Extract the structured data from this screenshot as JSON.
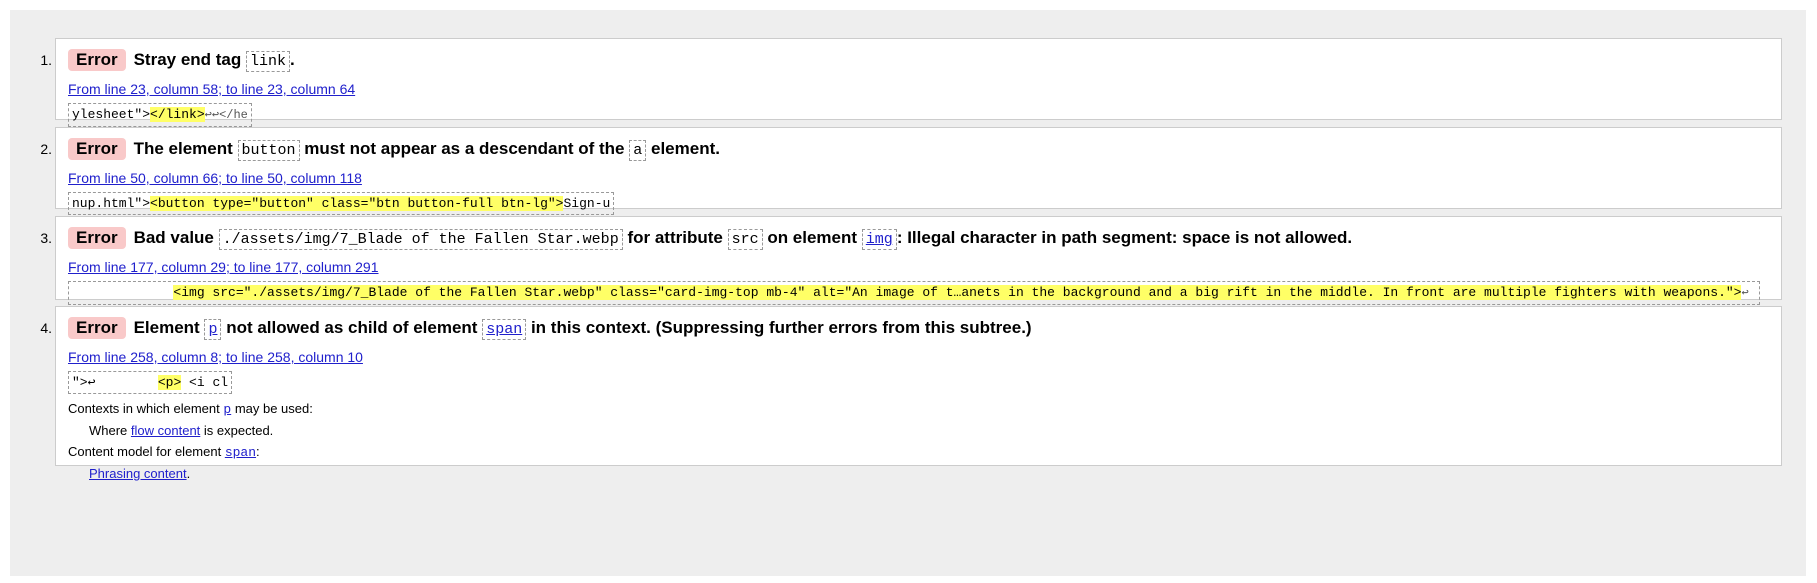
{
  "messages": [
    {
      "number": "1.",
      "type": "Error",
      "parts": [
        "Stray end tag",
        "link",
        "."
      ],
      "location": "From line 23, column 58; to line 23, column 64",
      "extract_before": "ylesheet\">",
      "extract_highlight": "</link>",
      "extract_after": "↩↩</he"
    },
    {
      "number": "2.",
      "type": "Error",
      "parts": [
        "The element",
        "button",
        "must not appear as a descendant of the",
        "a",
        "element."
      ],
      "location": "From line 50, column 66; to line 50, column 118",
      "extract_before": "nup.html\">",
      "extract_highlight": "<button type=\"button\" class=\"btn button-full btn-lg\">",
      "extract_after": "Sign-u"
    },
    {
      "number": "3.",
      "type": "Error",
      "parts": [
        "Bad value",
        "./assets/img/7_Blade of the Fallen Star.webp",
        "for attribute",
        "src",
        "on element",
        "img",
        ": Illegal character in path segment: space is not allowed."
      ],
      "location": "From line 177, column 29; to line 177, column 291",
      "extract_before": "             ",
      "extract_highlight": "<img src=\"./assets/img/7_Blade of the Fallen Star.webp\" class=\"card-img-top mb-4\" alt=\"An image of t…anets in the background and a big rift in the middle. In front are multiple fighters with weapons.\">",
      "extract_after": "↩"
    },
    {
      "number": "4.",
      "type": "Error",
      "parts": [
        "Element",
        "p",
        "not allowed as child of element",
        "span",
        "in this context. (Suppressing further errors from this subtree.)"
      ],
      "location": "From line 258, column 8; to line 258, column 10",
      "extract_before": "\">↩        ",
      "extract_highlight": "<p>",
      "extract_after": " <i cl",
      "info": {
        "contexts_prefix": "Contexts in which element",
        "contexts_el": "p",
        "contexts_suffix": "may be used:",
        "where_prefix": "Where",
        "where_link": "flow content",
        "where_suffix": "is expected.",
        "model_prefix": "Content model for element",
        "model_el": "span",
        "model_suffix": ":",
        "phrasing_link": "Phrasing content",
        "phrasing_suffix": "."
      }
    }
  ]
}
